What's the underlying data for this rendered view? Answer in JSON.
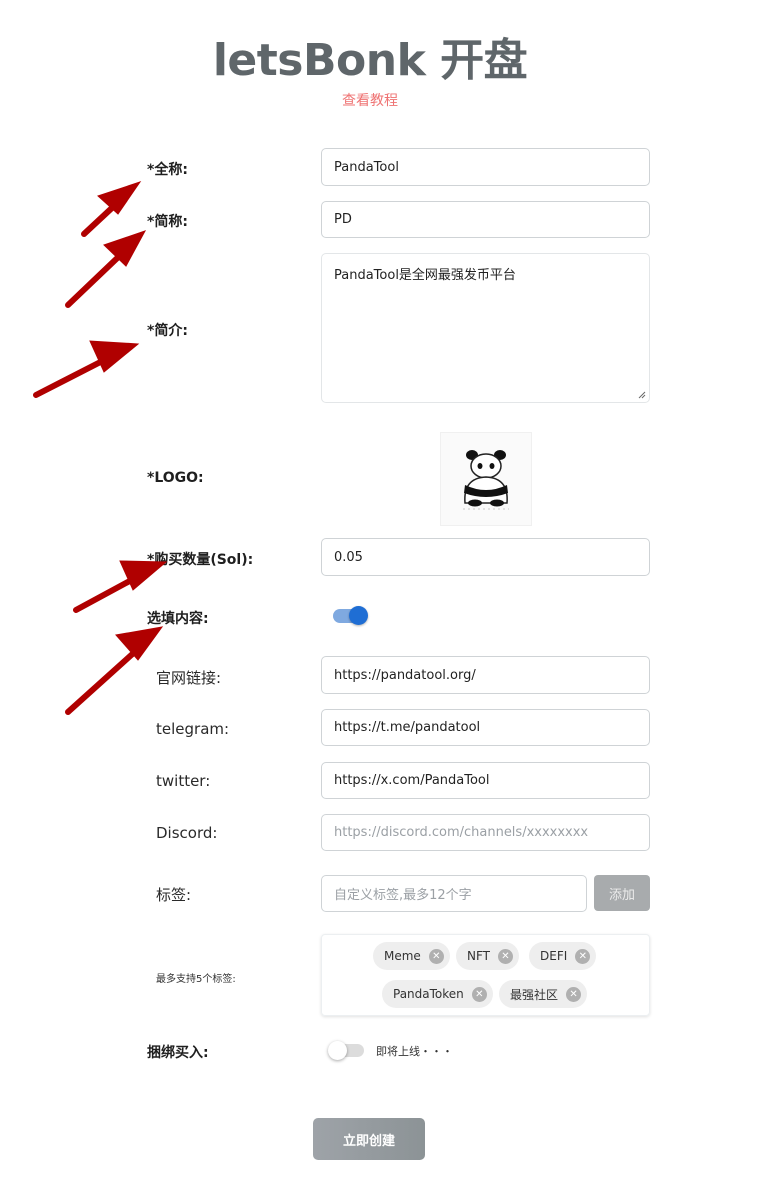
{
  "header": {
    "title": "letsBonk 开盘",
    "tutorial_link": "查看教程"
  },
  "form": {
    "full_name": {
      "label": "*全称:",
      "value": "PandaTool"
    },
    "short_name": {
      "label": "*简称:",
      "value": "PD"
    },
    "description": {
      "label": "*简介:",
      "value": "PandaTool是全网最强发币平台"
    },
    "logo": {
      "label": "*LOGO:"
    },
    "buy_amount": {
      "label": "*购买数量(Sol):",
      "value": "0.05"
    },
    "optional": {
      "label": "选填内容:"
    },
    "website": {
      "label": "官网链接:",
      "value": "https://pandatool.org/"
    },
    "telegram": {
      "label": "telegram:",
      "value": "https://t.me/pandatool"
    },
    "twitter": {
      "label": "twitter:",
      "value": "https://x.com/PandaTool"
    },
    "discord": {
      "label": "Discord:",
      "placeholder": "https://discord.com/channels/xxxxxxxx"
    },
    "tags": {
      "label": "标签:",
      "placeholder": "自定义标签,最多12个字",
      "add_label": "添加",
      "hint": "最多支持5个标签:",
      "items": [
        "Meme",
        "NFT",
        "DEFI",
        "PandaToken",
        "最强社区"
      ]
    },
    "bundle_buy": {
      "label": "捆绑买入:",
      "status": "即将上线・・・"
    },
    "submit_label": "立即创建"
  },
  "colors": {
    "accent": "#1f6ed4",
    "link": "#ef7373",
    "annotation_arrow": "#b00000"
  }
}
